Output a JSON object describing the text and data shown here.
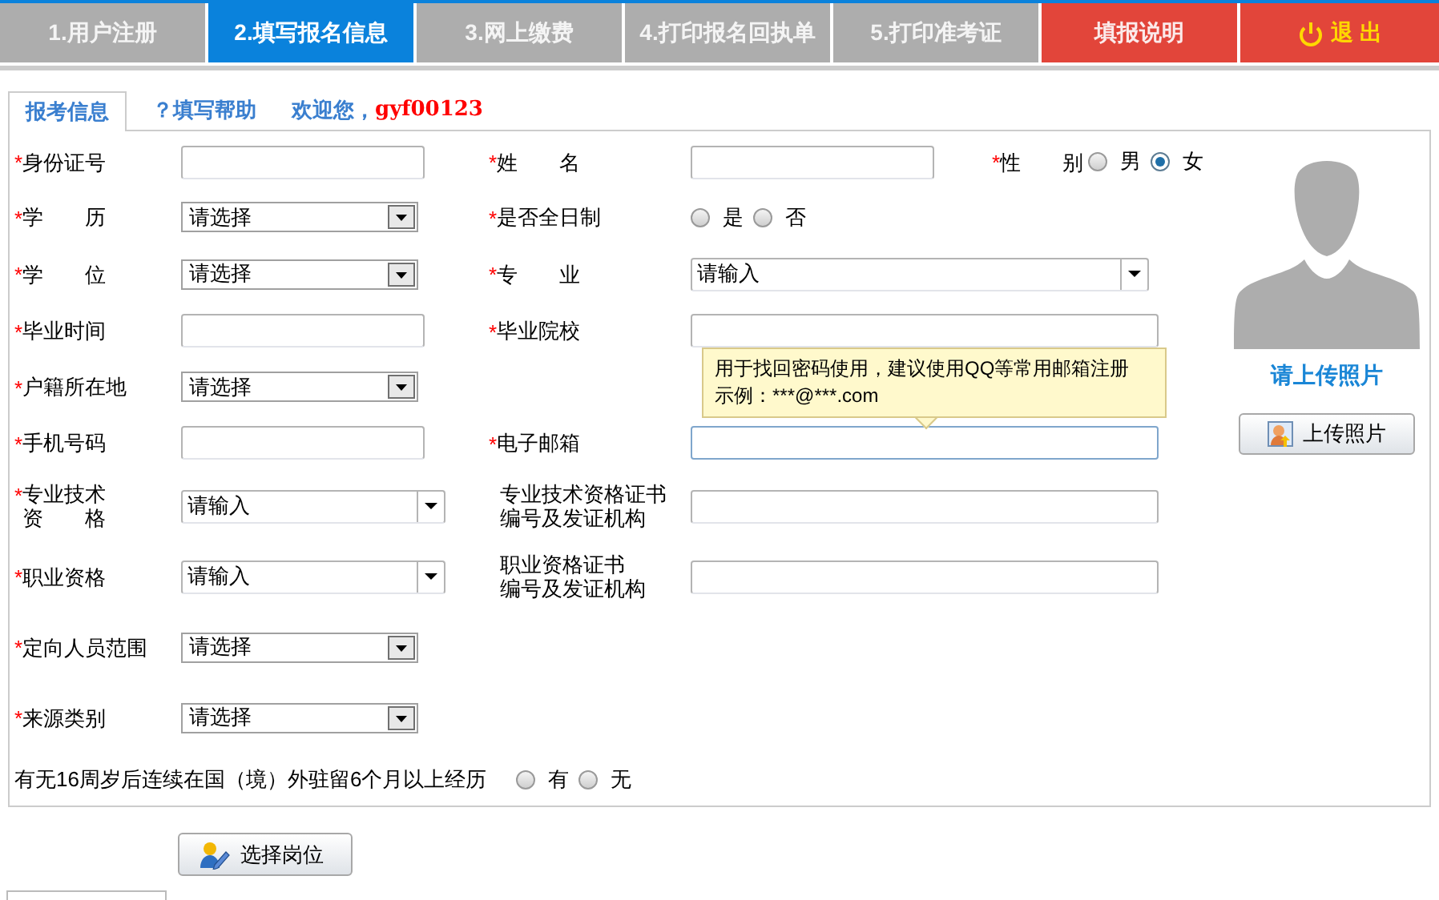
{
  "steps": [
    {
      "label": "1.用户注册",
      "kind": "step",
      "selected": false
    },
    {
      "label": "2.填写报名信息",
      "kind": "step",
      "selected": true
    },
    {
      "label": "3.网上缴费",
      "kind": "step",
      "selected": false
    },
    {
      "label": "4.打印报名回执单",
      "kind": "step",
      "selected": false
    },
    {
      "label": "5.打印准考证",
      "kind": "step",
      "selected": false
    },
    {
      "label": "填报说明",
      "kind": "help"
    },
    {
      "label": "退 出",
      "kind": "logout"
    }
  ],
  "subtabs": [
    {
      "label": "报考信息",
      "selected": true
    },
    {
      "label": "？填写帮助",
      "selected": false
    }
  ],
  "welcome": {
    "text": "欢迎您，",
    "username": "gyf00123"
  },
  "rows": [
    {
      "fields": [
        {
          "mark": "*",
          "label": [
            "身份证号"
          ],
          "kind": "text"
        },
        {
          "mark": "*",
          "label": [
            "姓　　名"
          ],
          "kind": "text"
        },
        {
          "mark": "*",
          "label": [
            "性　　别"
          ],
          "kind": "radio",
          "options": [
            {
              "label": "男",
              "selected": false
            },
            {
              "label": "女",
              "selected": true
            }
          ]
        }
      ]
    },
    {
      "fields": [
        {
          "mark": "*",
          "label": [
            "学　　历"
          ],
          "kind": "select",
          "value": "请选择"
        },
        {
          "mark": "*",
          "label": [
            "是否全日制"
          ],
          "kind": "radio",
          "options": [
            {
              "label": "是",
              "selected": false
            },
            {
              "label": "否",
              "selected": false
            }
          ]
        }
      ]
    },
    {
      "fields": [
        {
          "mark": "*",
          "label": [
            "学　　位"
          ],
          "kind": "select",
          "value": "请选择"
        },
        {
          "mark": "*",
          "label": [
            "专　　业"
          ],
          "kind": "combo",
          "value": "请输入"
        }
      ]
    },
    {
      "fields": [
        {
          "mark": "*",
          "label": [
            "毕业时间"
          ],
          "kind": "text"
        },
        {
          "mark": "*",
          "label": [
            "毕业院校"
          ],
          "kind": "text"
        }
      ]
    },
    {
      "fields": [
        {
          "mark": "*",
          "label": [
            "户籍所在地"
          ],
          "kind": "select",
          "value": "请选择"
        }
      ]
    },
    {
      "fields": [
        {
          "mark": "*",
          "label": [
            "手机号码"
          ],
          "kind": "text"
        },
        {
          "mark": "*",
          "label": [
            "电子邮箱"
          ],
          "kind": "text",
          "focused": true,
          "tooltip": [
            "用于找回密码使用，建议使用QQ等常用邮箱注册",
            "示例：***@***.com"
          ]
        }
      ]
    },
    {
      "fields": [
        {
          "mark": "*",
          "label": [
            "专业技术",
            "资　　格"
          ],
          "kind": "combo",
          "value": "请输入"
        },
        {
          "label": [
            "专业技术资格证书",
            "编号及发证机构"
          ],
          "kind": "text"
        }
      ]
    },
    {
      "fields": [
        {
          "mark": "*",
          "label": [
            "职业资格"
          ],
          "kind": "combo",
          "value": "请输入"
        },
        {
          "label": [
            "职业资格证书",
            "编号及发证机构"
          ],
          "kind": "text"
        }
      ]
    },
    {
      "fields": [
        {
          "mark": "*",
          "label": [
            "定向人员范围"
          ],
          "kind": "select",
          "value": "请选择"
        }
      ]
    },
    {
      "fields": [
        {
          "mark": "*",
          "label": [
            "来源类别"
          ],
          "kind": "select",
          "value": "请选择"
        }
      ]
    }
  ],
  "abroad": {
    "label": "有无16周岁后连续在国（境）外驻留6个月以上经历",
    "options": [
      {
        "label": "有",
        "selected": false
      },
      {
        "label": "无",
        "selected": false
      }
    ]
  },
  "photo": {
    "caption": "请上传照片",
    "button": "上传照片"
  },
  "submit": "选择岗位"
}
